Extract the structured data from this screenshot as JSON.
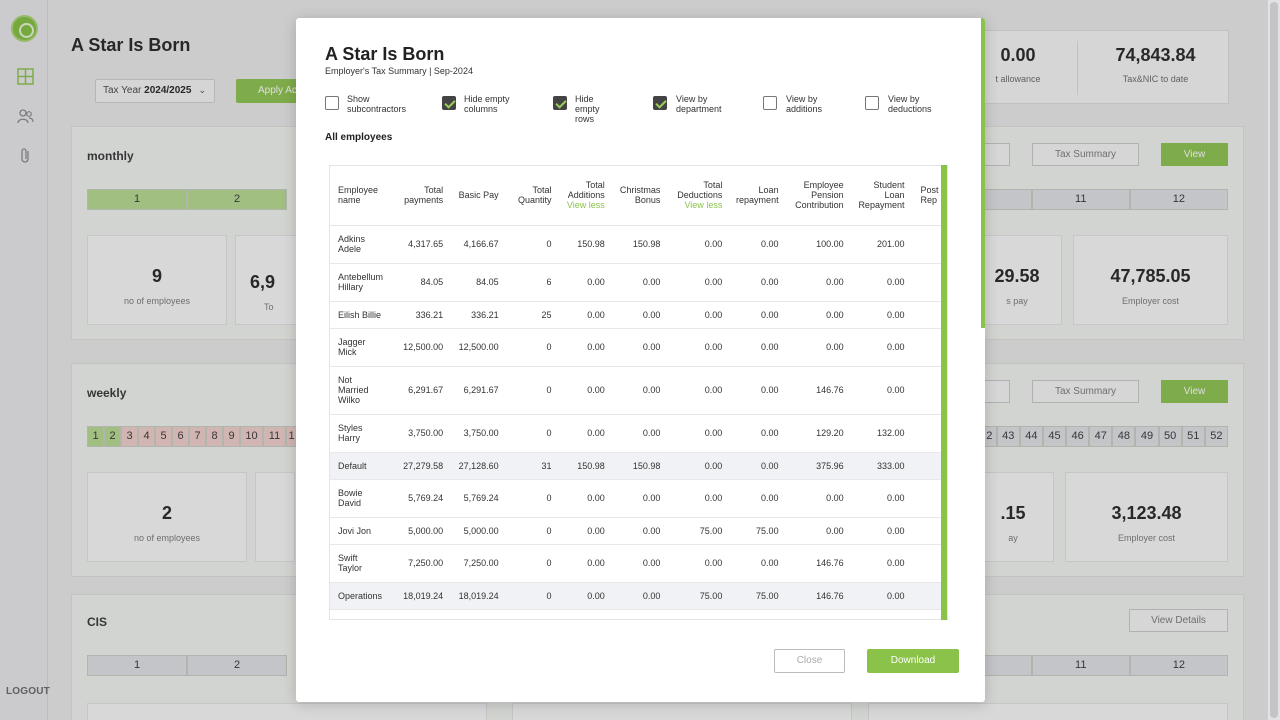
{
  "app": {
    "company": "A Star Is Born",
    "logout": "LOGOUT",
    "tax_year_label": "Tax Year",
    "tax_year_value": "2024/2025",
    "apply_label": "Apply Ac",
    "icons": [
      "logo-icon",
      "dashboard-icon",
      "users-icon",
      "attachment-icon",
      "chevron-down-icon"
    ]
  },
  "top_stats": [
    {
      "value": "0.00",
      "label": "t allowance"
    },
    {
      "value": "74,843.84",
      "label": "Tax&NIC to date"
    }
  ],
  "sections": {
    "monthly": {
      "title": "monthly",
      "tax_summary": "Tax Summary",
      "view": "View",
      "periods_left": [
        "1",
        "2"
      ],
      "periods_right": [
        "11",
        "12"
      ],
      "cards": [
        {
          "value": "9",
          "label": "no of employees"
        },
        {
          "value": "6,9",
          "label": "To"
        },
        {
          "value": "29.58",
          "label": "s pay"
        },
        {
          "value": "47,785.05",
          "label": "Employer cost"
        }
      ]
    },
    "weekly": {
      "title": "weekly",
      "tax_summary": "Tax Summary",
      "view": "View",
      "periods_left": [
        "1",
        "2",
        "3",
        "4",
        "5",
        "6",
        "7",
        "8",
        "9",
        "10",
        "11",
        "1"
      ],
      "periods_right": [
        "2",
        "43",
        "44",
        "45",
        "46",
        "47",
        "48",
        "49",
        "50",
        "51",
        "52"
      ],
      "cards": [
        {
          "value": "2",
          "label": "no of employees"
        },
        {
          "value": ".15",
          "label": "ay"
        },
        {
          "value": "3,123.48",
          "label": "Employer cost"
        }
      ]
    },
    "cis": {
      "title": "CIS",
      "view_details": "View Details",
      "periods_left": [
        "1",
        "2"
      ],
      "periods_right": [
        "11",
        "12"
      ]
    }
  },
  "modal": {
    "title": "A Star Is Born",
    "subtitle": "Employer's Tax Summary |  Sep-2024",
    "options": [
      {
        "label": "Show subcontractors",
        "checked": false
      },
      {
        "label": "Hide empty columns",
        "checked": true
      },
      {
        "label": "Hide empty rows",
        "checked": true
      },
      {
        "label": "View by department",
        "checked": true
      },
      {
        "label": "View by additions",
        "checked": false
      },
      {
        "label": "View by deductions",
        "checked": false
      }
    ],
    "group_label": "All employees",
    "view_less": "View less",
    "columns": [
      "Employee name",
      "Total payments",
      "Basic Pay",
      "Total Quantity",
      "Total Additions",
      "Christmas Bonus",
      "Total Deductions",
      "Loan repayment",
      "Employee Pension Contribution",
      "Student Loan Repayment",
      "Post Rep"
    ],
    "rows": [
      {
        "cells": [
          "Adkins Adele",
          "4,317.65",
          "4,166.67",
          "0",
          "150.98",
          "150.98",
          "0.00",
          "0.00",
          "100.00",
          "201.00"
        ],
        "summary": false
      },
      {
        "cells": [
          "Antebellum Hillary",
          "84.05",
          "84.05",
          "6",
          "0.00",
          "0.00",
          "0.00",
          "0.00",
          "0.00",
          "0.00"
        ],
        "summary": false
      },
      {
        "cells": [
          "Eilish Billie",
          "336.21",
          "336.21",
          "25",
          "0.00",
          "0.00",
          "0.00",
          "0.00",
          "0.00",
          "0.00"
        ],
        "summary": false
      },
      {
        "cells": [
          "Jagger Mick",
          "12,500.00",
          "12,500.00",
          "0",
          "0.00",
          "0.00",
          "0.00",
          "0.00",
          "0.00",
          "0.00"
        ],
        "summary": false
      },
      {
        "cells": [
          "Not Married Wilko",
          "6,291.67",
          "6,291.67",
          "0",
          "0.00",
          "0.00",
          "0.00",
          "0.00",
          "146.76",
          "0.00"
        ],
        "summary": false
      },
      {
        "cells": [
          "Styles Harry",
          "3,750.00",
          "3,750.00",
          "0",
          "0.00",
          "0.00",
          "0.00",
          "0.00",
          "129.20",
          "132.00"
        ],
        "summary": false
      },
      {
        "cells": [
          "Default",
          "27,279.58",
          "27,128.60",
          "31",
          "150.98",
          "150.98",
          "0.00",
          "0.00",
          "375.96",
          "333.00"
        ],
        "summary": true
      },
      {
        "cells": [
          "Bowie David",
          "5,769.24",
          "5,769.24",
          "0",
          "0.00",
          "0.00",
          "0.00",
          "0.00",
          "0.00",
          "0.00"
        ],
        "summary": false
      },
      {
        "cells": [
          "Jovi Jon",
          "5,000.00",
          "5,000.00",
          "0",
          "0.00",
          "0.00",
          "75.00",
          "75.00",
          "0.00",
          "0.00"
        ],
        "summary": false
      },
      {
        "cells": [
          "Swift Taylor",
          "7,250.00",
          "7,250.00",
          "0",
          "0.00",
          "0.00",
          "0.00",
          "0.00",
          "146.76",
          "0.00"
        ],
        "summary": false
      },
      {
        "cells": [
          "Operations",
          "18,019.24",
          "18,019.24",
          "0",
          "0.00",
          "0.00",
          "75.00",
          "75.00",
          "146.76",
          "0.00"
        ],
        "summary": true
      }
    ],
    "close_label": "Close",
    "download_label": "Download"
  }
}
